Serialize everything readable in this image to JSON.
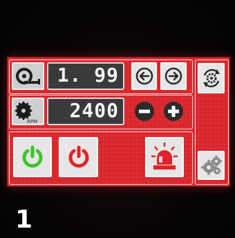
{
  "panel": {
    "length_value": "1. 99",
    "speed_value": "2400",
    "speed_unit": "RPM"
  },
  "caption": {
    "number": "1"
  },
  "icons": {
    "length": "tape-measure-icon",
    "speed": "saw-blade-icon",
    "left": "arrow-left-circle-icon",
    "right": "arrow-right-circle-icon",
    "minus": "minus-circle-icon",
    "plus": "plus-circle-icon",
    "power_on": "power-green-icon",
    "power_off": "power-red-icon",
    "alarm": "alarm-beacon-icon",
    "sync": "gear-cycle-icon",
    "settings": "gears-settings-icon"
  },
  "colors": {
    "panel_red": "#d8262b",
    "display_bg": "#3a3a3a",
    "power_green": "#3fc22b",
    "power_red": "#e0242a"
  }
}
